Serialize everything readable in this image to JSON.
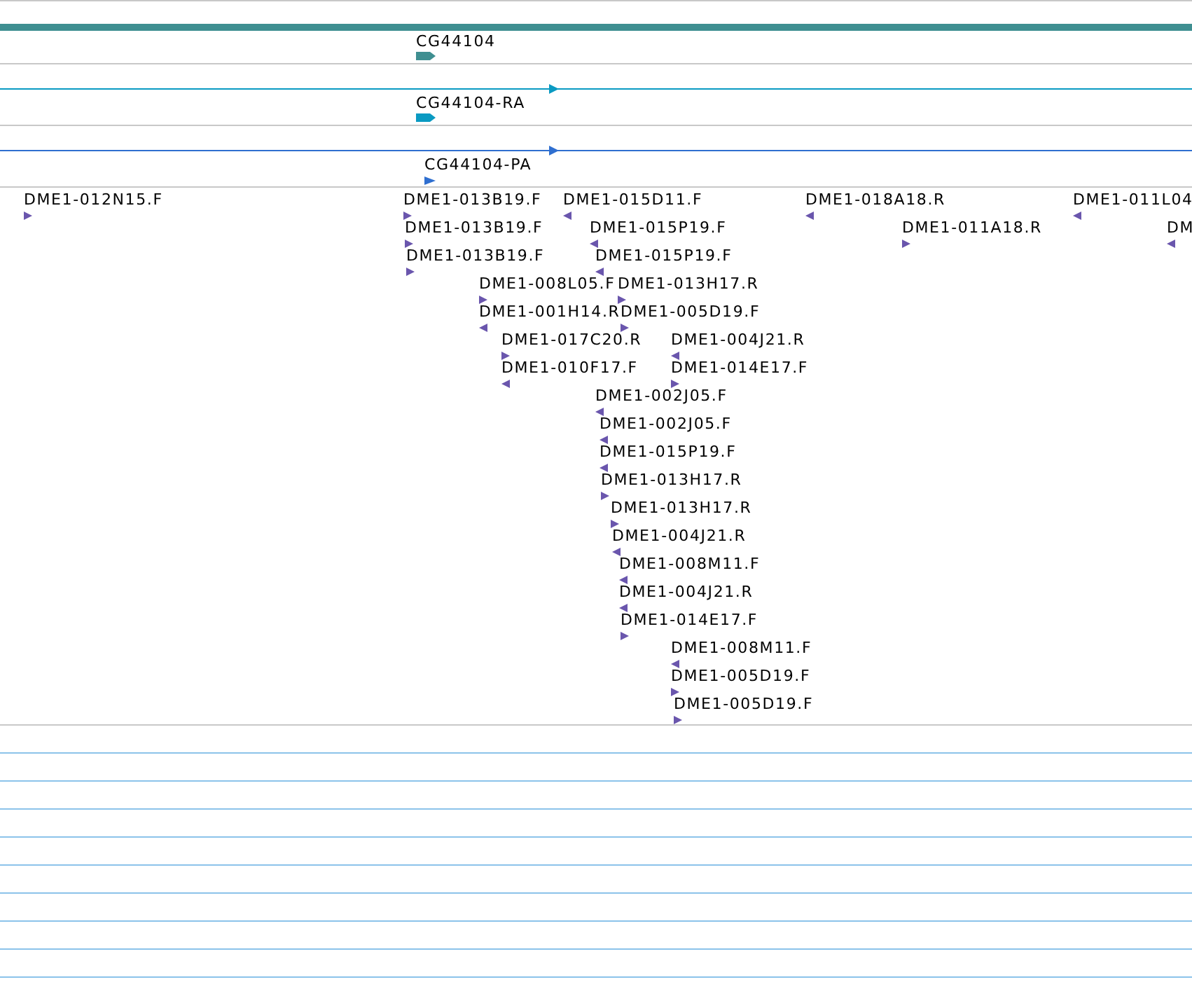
{
  "tracks": [
    {
      "kind": "gene",
      "label": "CG44104",
      "color": "#3f8f91"
    },
    {
      "kind": "transcript",
      "label": "CG44104-RA",
      "color": "#0a9ac2"
    },
    {
      "kind": "protein",
      "label": "CG44104-PA",
      "color": "#2f6fd0"
    }
  ],
  "features": [
    {
      "label": "DME1-012N15.F",
      "reverse": false
    },
    {
      "label": "DME1-013B19.F",
      "reverse": false
    },
    {
      "label": "DME1-015D11.F",
      "reverse": true
    },
    {
      "label": "DME1-018A18.R",
      "reverse": true
    },
    {
      "label": "DME1-011L04",
      "reverse": true
    },
    {
      "label": "DME1-013B19.F",
      "reverse": false
    },
    {
      "label": "DME1-015P19.F",
      "reverse": true
    },
    {
      "label": "DME1-011A18.R",
      "reverse": false
    },
    {
      "label": "DM",
      "reverse": true
    },
    {
      "label": "DME1-013B19.F",
      "reverse": false
    },
    {
      "label": "DME1-015P19.F",
      "reverse": true
    },
    {
      "label": "DME1-008L05.F",
      "reverse": false
    },
    {
      "label": "DME1-013H17.R",
      "reverse": false
    },
    {
      "label": "DME1-001H14.R",
      "reverse": true
    },
    {
      "label": "DME1-005D19.F",
      "reverse": false
    },
    {
      "label": "DME1-017C20.R",
      "reverse": false
    },
    {
      "label": "DME1-004J21.R",
      "reverse": true
    },
    {
      "label": "DME1-010F17.F",
      "reverse": true
    },
    {
      "label": "DME1-014E17.F",
      "reverse": false
    },
    {
      "label": "DME1-002J05.F",
      "reverse": true
    },
    {
      "label": "DME1-002J05.F",
      "reverse": true
    },
    {
      "label": "DME1-015P19.F",
      "reverse": true
    },
    {
      "label": "DME1-013H17.R",
      "reverse": false
    },
    {
      "label": "DME1-013H17.R",
      "reverse": false
    },
    {
      "label": "DME1-004J21.R",
      "reverse": true
    },
    {
      "label": "DME1-008M11.F",
      "reverse": true
    },
    {
      "label": "DME1-004J21.R",
      "reverse": true
    },
    {
      "label": "DME1-014E17.F",
      "reverse": false
    },
    {
      "label": "DME1-008M11.F",
      "reverse": true
    },
    {
      "label": "DME1-005D19.F",
      "reverse": false
    },
    {
      "label": "DME1-005D19.F",
      "reverse": false
    }
  ]
}
